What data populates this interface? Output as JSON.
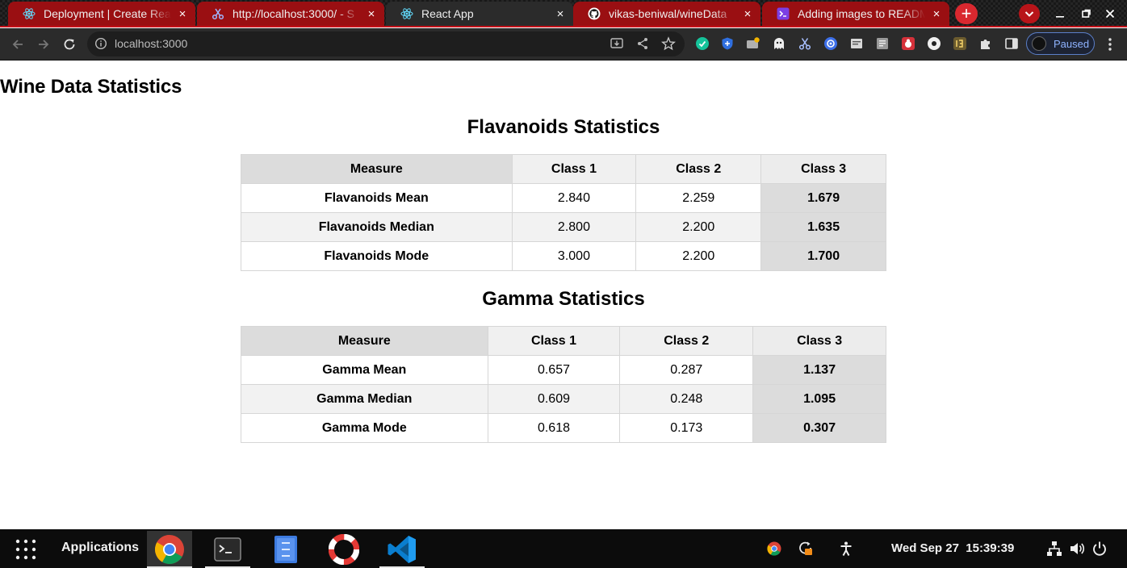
{
  "browser": {
    "tabs": [
      {
        "title": "Deployment | Create Rea",
        "icon": "react-icon",
        "active": false
      },
      {
        "title": "http://localhost:3000/ - S",
        "icon": "scissors-icon",
        "active": false
      },
      {
        "title": "React App",
        "icon": "react-icon",
        "active": true
      },
      {
        "title": "vikas-beniwal/wineData",
        "icon": "github-icon",
        "active": false
      },
      {
        "title": "Adding images to READM",
        "icon": "terminal-prompt-icon",
        "active": false
      }
    ],
    "close_glyph": "×",
    "new_tab_glyph": "+",
    "url": "localhost:3000",
    "profile_label": "Paused",
    "colors": {
      "tab_strip": "#181818",
      "inactive_tab": "#9a0f12",
      "active_tab": "#2b2b2b",
      "accent": "#d9282f"
    }
  },
  "page": {
    "title": "Wine Data Statistics",
    "tables": [
      {
        "title": "Flavanoids Statistics",
        "headers": [
          "Measure",
          "Class 1",
          "Class 2",
          "Class 3"
        ],
        "rows": [
          [
            "Flavanoids Mean",
            "2.840",
            "2.259",
            "1.679"
          ],
          [
            "Flavanoids Median",
            "2.800",
            "2.200",
            "1.635"
          ],
          [
            "Flavanoids Mode",
            "3.000",
            "2.200",
            "1.700"
          ]
        ]
      },
      {
        "title": "Gamma Statistics",
        "headers": [
          "Measure",
          "Class 1",
          "Class 2",
          "Class 3"
        ],
        "rows": [
          [
            "Gamma Mean",
            "0.657",
            "0.287",
            "1.137"
          ],
          [
            "Gamma Median",
            "0.609",
            "0.248",
            "1.095"
          ],
          [
            "Gamma Mode",
            "0.618",
            "0.173",
            "0.307"
          ]
        ]
      }
    ]
  },
  "taskbar": {
    "applications_label": "Applications",
    "apps": [
      {
        "name": "chrome-icon",
        "running": true,
        "focused": true
      },
      {
        "name": "terminal-icon",
        "running": true,
        "focused": false
      },
      {
        "name": "file-manager-icon",
        "running": false,
        "focused": false
      },
      {
        "name": "help-lifebuoy-icon",
        "running": false,
        "focused": false
      },
      {
        "name": "vscode-icon",
        "running": true,
        "focused": false
      }
    ],
    "clock": "Wed Sep 27  15:39:39"
  }
}
